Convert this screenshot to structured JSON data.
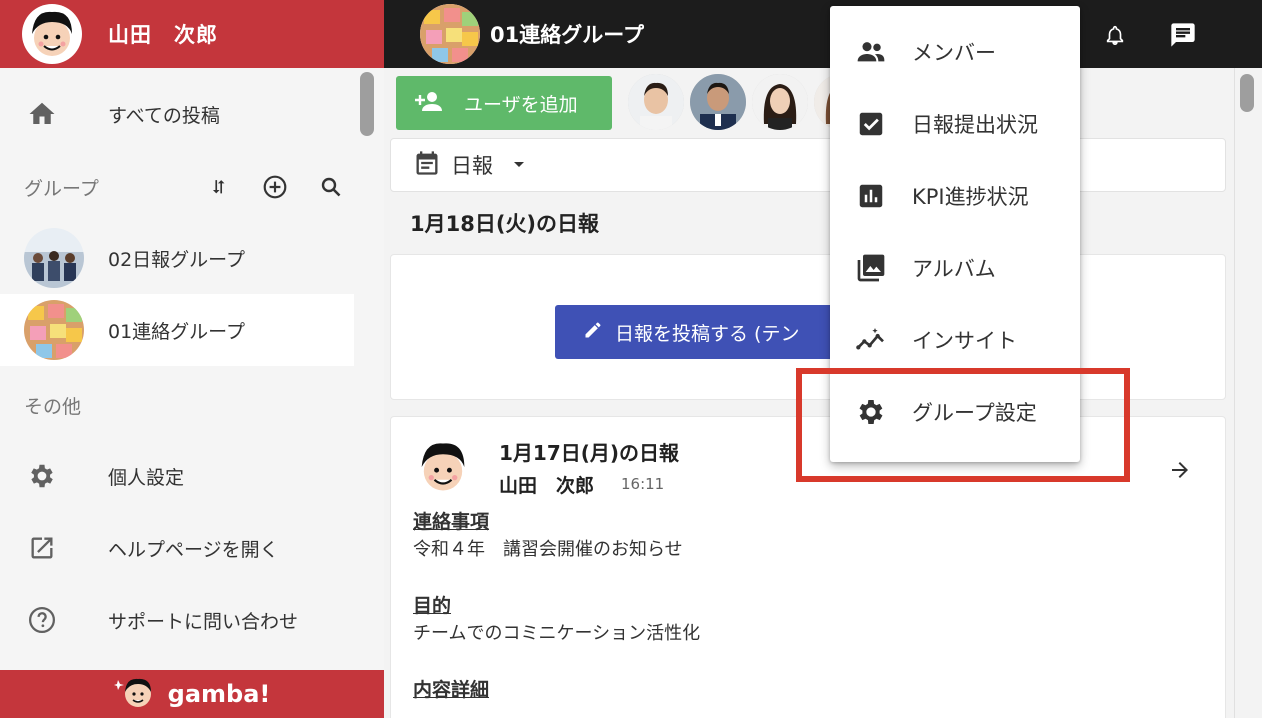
{
  "user": {
    "name": "山田　次郎"
  },
  "sidebar": {
    "all_posts": "すべての投稿",
    "groups_label": "グループ",
    "groups": [
      {
        "name": "02日報グループ"
      },
      {
        "name": "01連絡グループ"
      }
    ],
    "other_label": "その他",
    "other_items": [
      {
        "label": "個人設定",
        "icon": "gear-icon"
      },
      {
        "label": "ヘルプページを開く",
        "icon": "open-in-new-icon"
      },
      {
        "label": "サポートに問い合わせ",
        "icon": "help-circle-icon"
      }
    ],
    "brand": "gamba!"
  },
  "topbar": {
    "group_title": "01連絡グループ"
  },
  "main": {
    "add_user_label": "ユーザを追加",
    "filter_label": "日報",
    "date_heading": "1月18日(火)の日報",
    "post_button_label": "日報を投稿する (テン",
    "report": {
      "title": "1月17日(月)の日報",
      "author": "山田　次郎",
      "time": "16:11",
      "sections": [
        {
          "heading": "連絡事項",
          "body": "令和４年　講習会開催のお知らせ"
        },
        {
          "heading": "目的",
          "body": "チームでのコミニケーション活性化"
        },
        {
          "heading": "内容詳細",
          "body": ""
        }
      ]
    }
  },
  "menu": {
    "items": [
      {
        "label": "メンバー",
        "icon": "people-icon"
      },
      {
        "label": "日報提出状況",
        "icon": "checkbox-icon"
      },
      {
        "label": "KPI進捗状況",
        "icon": "bar-chart-icon"
      },
      {
        "label": "アルバム",
        "icon": "photo-library-icon"
      },
      {
        "label": "インサイト",
        "icon": "insights-icon"
      },
      {
        "label": "グループ設定",
        "icon": "gear-icon"
      }
    ]
  },
  "colors": {
    "brand_red": "#c4363c",
    "topbar_black": "#1c1c1c",
    "add_user_green": "#5fb96a",
    "post_button_blue": "#3f51b5",
    "highlight_red": "#d8392b"
  }
}
